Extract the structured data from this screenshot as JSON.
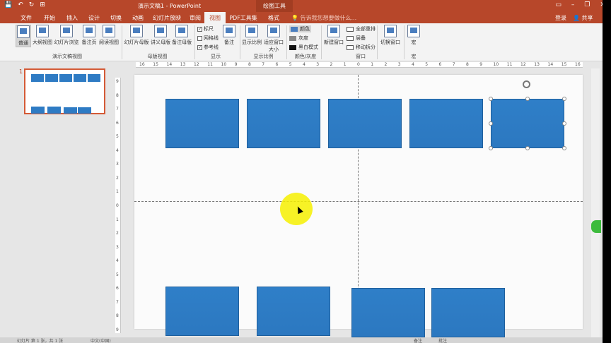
{
  "window": {
    "title": "演示文稿1 - PowerPoint",
    "context_tab": "绘图工具",
    "quick_access": [
      "💾",
      "↶",
      "↻",
      "⊞"
    ],
    "win_controls": [
      "▭",
      "–",
      "❐",
      "✕"
    ]
  },
  "tabs": [
    {
      "label": "文件"
    },
    {
      "label": "开始"
    },
    {
      "label": "插入"
    },
    {
      "label": "设计"
    },
    {
      "label": "切换"
    },
    {
      "label": "动画"
    },
    {
      "label": "幻灯片放映"
    },
    {
      "label": "审阅"
    },
    {
      "label": "视图"
    },
    {
      "label": "PDF工具集"
    },
    {
      "label": "格式"
    }
  ],
  "tellme": "告诉我您想要做什么...",
  "login": "登录",
  "share": "共享",
  "ribbon": {
    "groups": [
      {
        "label": "演示文稿视图",
        "buttons": [
          "普通",
          "大纲视图",
          "幻灯片浏览",
          "备注页",
          "阅读视图"
        ]
      },
      {
        "label": "母版视图",
        "buttons": [
          "幻灯片母版",
          "讲义母版",
          "备注母版"
        ]
      },
      {
        "label": "显示",
        "checks": [
          "标尺",
          "网格线",
          "参考线"
        ],
        "button": "备注"
      },
      {
        "label": "显示比例",
        "buttons": [
          "显示比例",
          "适应窗口大小"
        ]
      },
      {
        "label": "颜色/灰度",
        "rows": [
          "颜色",
          "灰度",
          "黑白模式"
        ]
      },
      {
        "label": "窗口",
        "button": "新建窗口",
        "rows": [
          "全部重排",
          "层叠",
          "移动拆分"
        ]
      },
      {
        "label": "宏",
        "buttons": [
          "切换窗口",
          "宏"
        ]
      }
    ]
  },
  "ruler": {
    "h_labels": [
      "16",
      "15",
      "14",
      "13",
      "12",
      "11",
      "10",
      "9",
      "8",
      "7",
      "6",
      "5",
      "4",
      "3",
      "2",
      "1",
      "0",
      "1",
      "2",
      "3",
      "4",
      "5",
      "6",
      "7",
      "8",
      "9",
      "10",
      "11",
      "12",
      "13",
      "14",
      "15",
      "16"
    ],
    "v_labels": [
      "9",
      "8",
      "7",
      "6",
      "5",
      "4",
      "3",
      "2",
      "1",
      "0",
      "1",
      "2",
      "3",
      "4",
      "5",
      "6",
      "7",
      "8",
      "9"
    ]
  },
  "slide_number": "1",
  "status": {
    "slide_info": "幻灯片 第 1 张，共 1 张",
    "lang": "中文(中国)",
    "notes": "备注",
    "comments": "批注"
  },
  "colors": {
    "accent": "#b7472a",
    "shape_fill": "#2e7bc4",
    "selected_thumb_border": "#d45a36"
  }
}
